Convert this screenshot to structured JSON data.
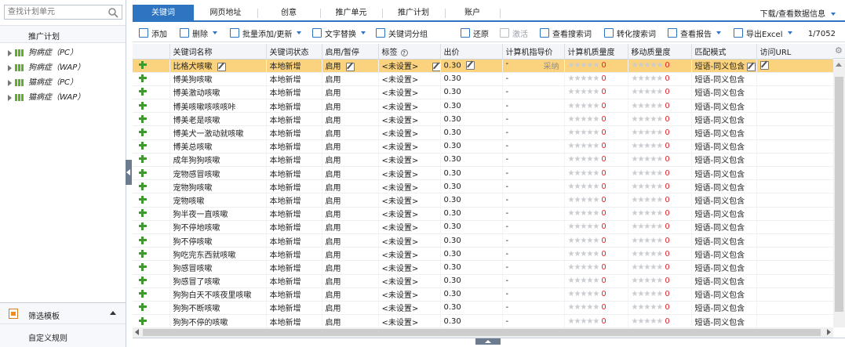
{
  "left_panel": {
    "search_placeholder": "查找计划单元",
    "plan_header": "推广计划",
    "plans": [
      "狗病症（PC）",
      "狗病症（WAP）",
      "猫病症（PC）",
      "猫病症（WAP）"
    ],
    "filter_template": "筛选模板",
    "custom_rule": "自定义规则"
  },
  "tabs": [
    "关键词",
    "网页地址",
    "创意",
    "推广单元",
    "推广计划",
    "账户"
  ],
  "download_report": "下载/查看数据信息",
  "toolbar": {
    "add": "添加",
    "delete": "删除",
    "batch_add": "批量添加/更新",
    "text_replace": "文字替换",
    "keyword_group": "关键词分组",
    "restore": "还原",
    "activate": "激活",
    "view_search_terms": "查看搜索词",
    "convert_search_terms": "转化搜索词",
    "view_report": "查看报告",
    "export_excel": "导出Excel",
    "count": "1/7052"
  },
  "columns": [
    "关键词名称",
    "关键词状态",
    "启用/暂停",
    "标签",
    "出价",
    "计算机指导价",
    "计算机质量度",
    "移动质量度",
    "匹配模式",
    "访问URL"
  ],
  "caiji_label": "采纳",
  "stars_text": "★★★★★",
  "rows": [
    {
      "name": "比格犬咳嗽",
      "status": "本地新增",
      "enable": "启用",
      "tag": "<未设置>",
      "bid": "0.30",
      "guide": "-",
      "pcq": "0",
      "mq": "0",
      "match": "短语-同义包含"
    },
    {
      "name": "博美狗咳嗽",
      "status": "本地新增",
      "enable": "启用",
      "tag": "<未设置>",
      "bid": "0.30",
      "guide": "-",
      "pcq": "0",
      "mq": "0",
      "match": "短语-同义包含"
    },
    {
      "name": "博美激动咳嗽",
      "status": "本地新增",
      "enable": "启用",
      "tag": "<未设置>",
      "bid": "0.30",
      "guide": "-",
      "pcq": "0",
      "mq": "0",
      "match": "短语-同义包含"
    },
    {
      "name": "博美咳嗽咳咳咳咔",
      "status": "本地新增",
      "enable": "启用",
      "tag": "<未设置>",
      "bid": "0.30",
      "guide": "-",
      "pcq": "0",
      "mq": "0",
      "match": "短语-同义包含"
    },
    {
      "name": "博美老是咳嗽",
      "status": "本地新增",
      "enable": "启用",
      "tag": "<未设置>",
      "bid": "0.30",
      "guide": "-",
      "pcq": "0",
      "mq": "0",
      "match": "短语-同义包含"
    },
    {
      "name": "博美犬一激动就咳嗽",
      "status": "本地新增",
      "enable": "启用",
      "tag": "<未设置>",
      "bid": "0.30",
      "guide": "-",
      "pcq": "0",
      "mq": "0",
      "match": "短语-同义包含"
    },
    {
      "name": "博美总咳嗽",
      "status": "本地新增",
      "enable": "启用",
      "tag": "<未设置>",
      "bid": "0.30",
      "guide": "-",
      "pcq": "0",
      "mq": "0",
      "match": "短语-同义包含"
    },
    {
      "name": "成年狗狗咳嗽",
      "status": "本地新增",
      "enable": "启用",
      "tag": "<未设置>",
      "bid": "0.30",
      "guide": "-",
      "pcq": "0",
      "mq": "0",
      "match": "短语-同义包含"
    },
    {
      "name": "宠物感冒咳嗽",
      "status": "本地新增",
      "enable": "启用",
      "tag": "<未设置>",
      "bid": "0.30",
      "guide": "-",
      "pcq": "0",
      "mq": "0",
      "match": "短语-同义包含"
    },
    {
      "name": "宠物狗咳嗽",
      "status": "本地新增",
      "enable": "启用",
      "tag": "<未设置>",
      "bid": "0.30",
      "guide": "-",
      "pcq": "0",
      "mq": "0",
      "match": "短语-同义包含"
    },
    {
      "name": "宠物咳嗽",
      "status": "本地新增",
      "enable": "启用",
      "tag": "<未设置>",
      "bid": "0.30",
      "guide": "-",
      "pcq": "0",
      "mq": "0",
      "match": "短语-同义包含"
    },
    {
      "name": "狗半夜一直咳嗽",
      "status": "本地新增",
      "enable": "启用",
      "tag": "<未设置>",
      "bid": "0.30",
      "guide": "-",
      "pcq": "0",
      "mq": "0",
      "match": "短语-同义包含"
    },
    {
      "name": "狗不停地咳嗽",
      "status": "本地新增",
      "enable": "启用",
      "tag": "<未设置>",
      "bid": "0.30",
      "guide": "-",
      "pcq": "0",
      "mq": "0",
      "match": "短语-同义包含"
    },
    {
      "name": "狗不停咳嗽",
      "status": "本地新增",
      "enable": "启用",
      "tag": "<未设置>",
      "bid": "0.30",
      "guide": "-",
      "pcq": "0",
      "mq": "0",
      "match": "短语-同义包含"
    },
    {
      "name": "狗吃完东西就咳嗽",
      "status": "本地新增",
      "enable": "启用",
      "tag": "<未设置>",
      "bid": "0.30",
      "guide": "-",
      "pcq": "0",
      "mq": "0",
      "match": "短语-同义包含"
    },
    {
      "name": "狗感冒咳嗽",
      "status": "本地新增",
      "enable": "启用",
      "tag": "<未设置>",
      "bid": "0.30",
      "guide": "-",
      "pcq": "0",
      "mq": "0",
      "match": "短语-同义包含"
    },
    {
      "name": "狗感冒了咳嗽",
      "status": "本地新增",
      "enable": "启用",
      "tag": "<未设置>",
      "bid": "0.30",
      "guide": "-",
      "pcq": "0",
      "mq": "0",
      "match": "短语-同义包含"
    },
    {
      "name": "狗狗白天不咳夜里咳嗽",
      "status": "本地新增",
      "enable": "启用",
      "tag": "<未设置>",
      "bid": "0.30",
      "guide": "-",
      "pcq": "0",
      "mq": "0",
      "match": "短语-同义包含"
    },
    {
      "name": "狗狗不断咳嗽",
      "status": "本地新增",
      "enable": "启用",
      "tag": "<未设置>",
      "bid": "0.30",
      "guide": "-",
      "pcq": "0",
      "mq": "0",
      "match": "短语-同义包含"
    },
    {
      "name": "狗狗不停的咳嗽",
      "status": "本地新增",
      "enable": "启用",
      "tag": "<未设置>",
      "bid": "0.30",
      "guide": "-",
      "pcq": "0",
      "mq": "0",
      "match": "短语-同义包含"
    }
  ]
}
